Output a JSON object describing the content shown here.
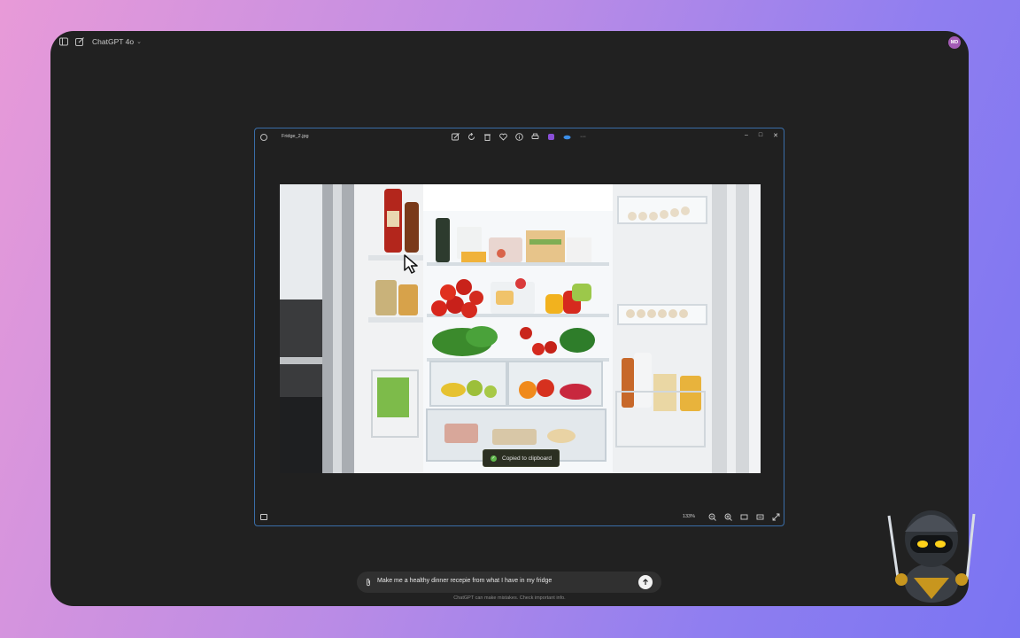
{
  "topbar": {
    "model_label": "ChatGPT 4o",
    "avatar_initials": "MD"
  },
  "viewer": {
    "filename": "Fridge_2.jpg",
    "toolbar_icons": [
      "edit-image-icon",
      "rotate-icon",
      "delete-icon",
      "favorite-icon",
      "info-icon",
      "print-icon",
      "clipchamp-icon",
      "onedrive-icon",
      "more-icon"
    ],
    "window_controls": {
      "minimize": "–",
      "maximize": "□",
      "close": "✕"
    },
    "zoom_level": "133%",
    "toast_text": "Copied to clipboard"
  },
  "composer": {
    "prompt": "Make me a healthy dinner recepie from what I have in my fridge"
  },
  "disclaimer": "ChatGPT can make mistakes. Check important info.",
  "colors": {
    "app_background": "#212121",
    "viewer_border": "#3a6ea8",
    "avatar": "#a35bb5",
    "toast_check": "#5fb84c"
  }
}
